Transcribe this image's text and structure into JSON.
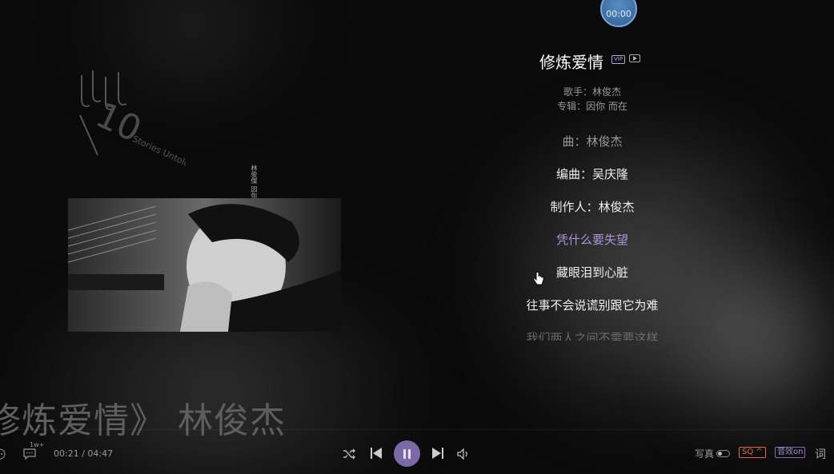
{
  "timer": {
    "text": "00:00"
  },
  "album": {
    "logo_text": "Stories Untold",
    "cover_chinese": "林俊傑 因你 而在"
  },
  "song": {
    "title": "修炼爱情",
    "vip_label": "VIP",
    "singer_line": "歌手：林俊杰",
    "album_line": "专辑：因你 而在"
  },
  "lyrics": [
    "曲：林俊杰",
    "编曲：吴庆隆",
    "制作人：林俊杰",
    "凭什么要失望",
    "藏眼泪到心脏",
    "往事不会说谎别跟它为难",
    "我们两人之间不需要这样"
  ],
  "marquee": {
    "text": "修炼爱情》 林俊杰"
  },
  "player": {
    "comment_count": "1w+",
    "time": "00:21 / 04:47",
    "xiezhen_label": "写真",
    "quality_label": "SQ ^",
    "effect_label": "音效on",
    "lyrics_label": "词"
  },
  "colors": {
    "accent": "#7c6aa8",
    "active_lyric": "#a796d8",
    "quality": "#e06a3a"
  }
}
